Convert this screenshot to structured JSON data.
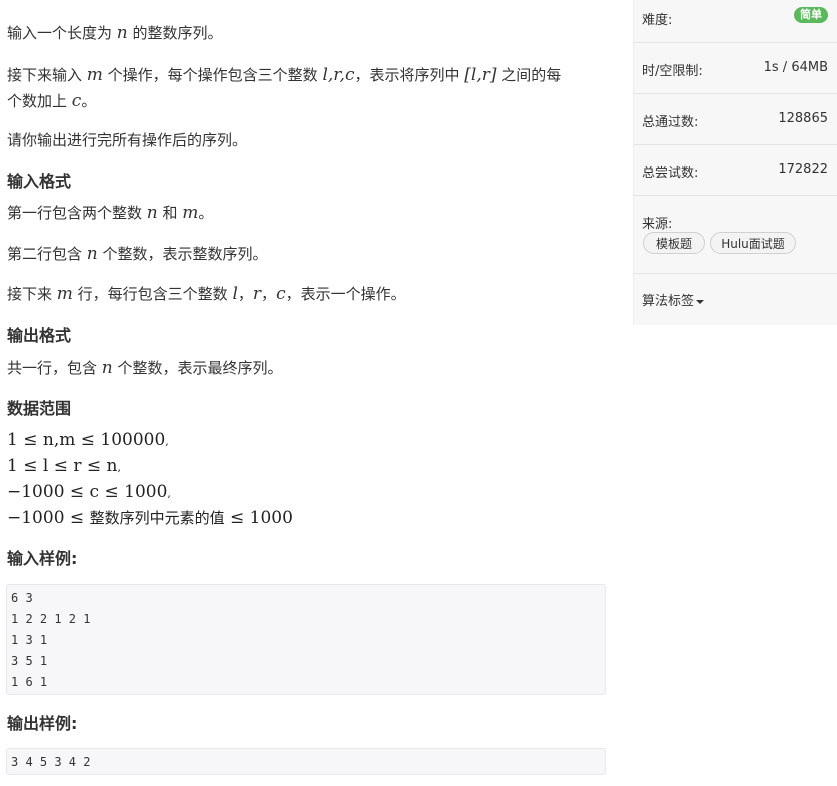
{
  "problem": {
    "desc1": [
      "输入一个长度为 ",
      "n",
      " 的整数序列。"
    ],
    "desc2_a": [
      "接下来输入 ",
      "m",
      " 个操作，每个操作包含三个整数 ",
      "l,r,c",
      "，表示将序列中 ",
      "[l,r]",
      " 之间的每"
    ],
    "desc2_b": [
      "个数加上 ",
      "c",
      "。"
    ],
    "desc3": "请你输出进行完所有操作后的序列。",
    "input_title": "输入格式",
    "input1": [
      "第一行包含两个整数 ",
      "n",
      " 和 ",
      "m",
      "。"
    ],
    "input2": [
      "第二行包含 ",
      "n",
      " 个整数，表示整数序列。"
    ],
    "input3": [
      "接下来 ",
      "m",
      " 行，每行包含三个整数 ",
      "l",
      "，",
      "r",
      "，",
      "c",
      "，表示一个操作。"
    ],
    "output_title": "输出格式",
    "output1": [
      "共一行，包含 ",
      "n",
      " 个整数，表示最终序列。"
    ],
    "range_title": "数据范围",
    "range": [
      "1 ≤ n,m ≤ 100000",
      "1 ≤ l ≤ r ≤ n",
      "−1000 ≤ c ≤ 1000",
      [
        "−1000 ≤ ",
        "整数序列中元素的值",
        " ≤ 1000"
      ]
    ],
    "sample_in_title": "输入样例:",
    "sample_in": [
      "6 3",
      "1 2 2 1 2 1",
      "1 3 1",
      "3 5 1",
      "1 6 1"
    ],
    "sample_out_title": "输出样例:",
    "sample_out": [
      "3 4 5 3 4 2"
    ]
  },
  "sidebar": {
    "difficulty_label": "难度:",
    "difficulty_value": "简单",
    "limit_label": "时/空限制:",
    "limit_value": "1s / 64MB",
    "passed_label": "总通过数:",
    "passed_value": "128865",
    "tried_label": "总尝试数:",
    "tried_value": "172822",
    "source_label": "来源:",
    "source_tags": [
      "模板题",
      "Hulu面试题"
    ],
    "algo_label": "算法标签"
  },
  "colors": {
    "badge": "#5cb85c",
    "sidebar_bg": "#f7f7f7",
    "code_bg": "#f7f7f9"
  }
}
